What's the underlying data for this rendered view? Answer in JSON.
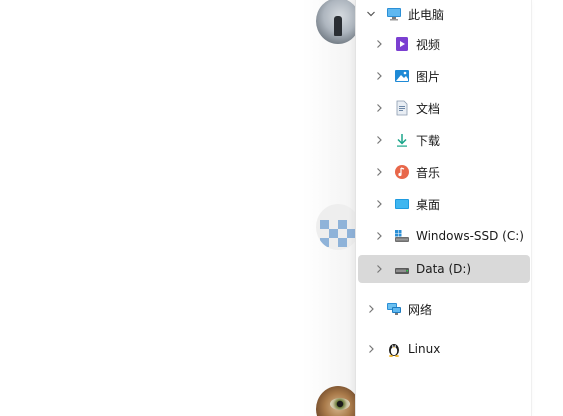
{
  "nav": {
    "this_pc": "此电脑",
    "items": [
      {
        "label": "视频",
        "icon": "videos-icon"
      },
      {
        "label": "图片",
        "icon": "pictures-icon"
      },
      {
        "label": "文档",
        "icon": "documents-icon"
      },
      {
        "label": "下载",
        "icon": "downloads-icon"
      },
      {
        "label": "音乐",
        "icon": "music-icon"
      },
      {
        "label": "桌面",
        "icon": "desktop-icon"
      },
      {
        "label": "Windows-SSD (C:)",
        "icon": "system-drive-icon"
      },
      {
        "label": "Data (D:)",
        "icon": "drive-icon"
      }
    ],
    "network": "网络",
    "linux": "Linux",
    "selected": "Data (D:)"
  },
  "colors": {
    "selected_row_bg": "#d9d9d9",
    "pc_icon": "#2b8fd6",
    "videos_icon": "#7b3fd1",
    "pictures_icon": "#1f8ad6",
    "downloads_icon": "#1aa58a",
    "music_icon": "#e8674a",
    "desktop_icon": "#1e9be0"
  }
}
